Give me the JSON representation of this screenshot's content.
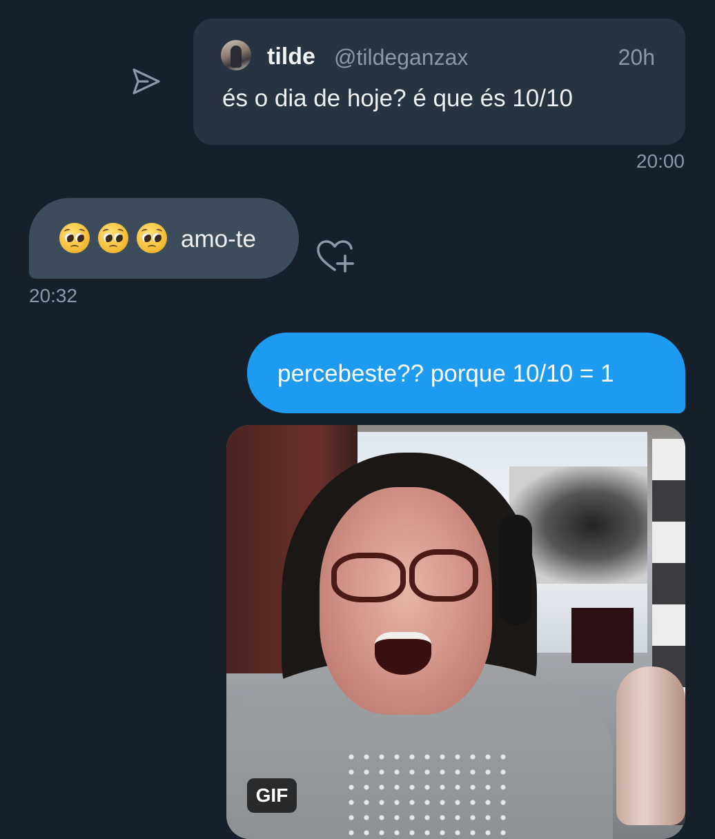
{
  "quoted_tweet": {
    "name": "tilde",
    "handle": "@tildeganzax",
    "time": "20h",
    "text": "és o dia de hoje? é que és 10/10"
  },
  "messages": [
    {
      "timestamp": "20:00"
    },
    {
      "text": "amo-te",
      "emoji": [
        "pleading-face-emoji",
        "pleading-face-emoji",
        "pleading-face-emoji"
      ],
      "timestamp": "20:32"
    },
    {
      "text": "percebeste?? porque 10/10 = 1"
    }
  ],
  "gif": {
    "badge": "GIF"
  },
  "icons": {
    "share": "share-icon",
    "react": "add-reaction-icon"
  },
  "colors": {
    "background": "#15202b",
    "incoming_bubble": "#3d4c5b",
    "quote_card": "#273340",
    "outgoing_bubble": "#1d9bf0",
    "muted_text": "#8b98a5"
  }
}
